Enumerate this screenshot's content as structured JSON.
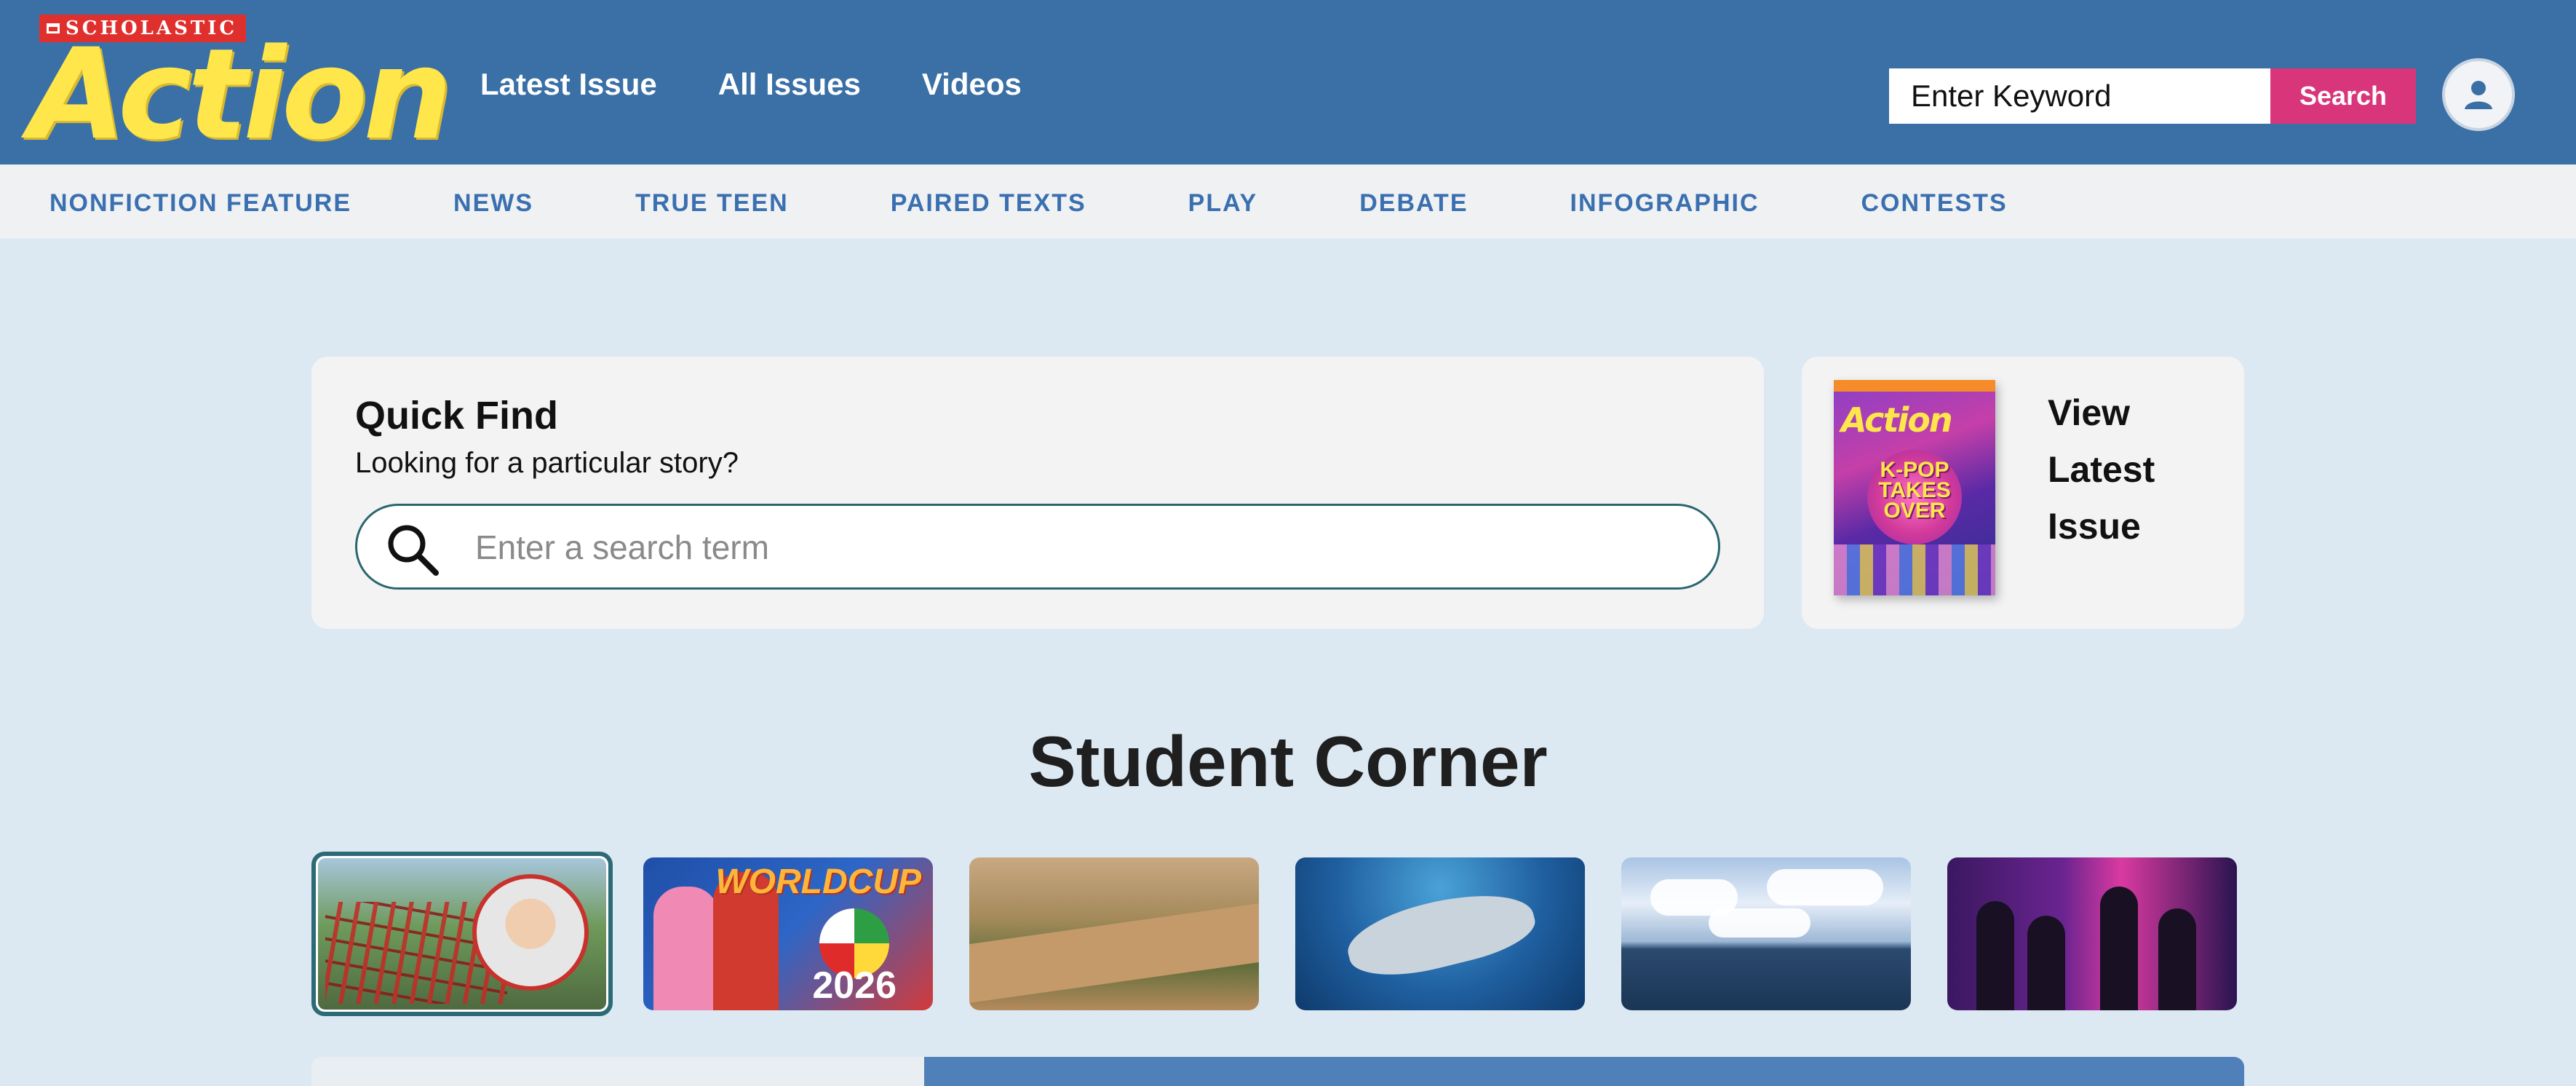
{
  "header": {
    "logo_badge": "SCHOLASTIC",
    "logo_word": "Action",
    "nav": [
      "Latest Issue",
      "All Issues",
      "Videos"
    ],
    "search": {
      "placeholder": "Enter Keyword",
      "button_label": "Search"
    },
    "account_icon": "user-icon"
  },
  "sub_nav": {
    "items": [
      "NONFICTION FEATURE",
      "NEWS",
      "TRUE TEEN",
      "PAIRED TEXTS",
      "PLAY",
      "DEBATE",
      "INFOGRAPHIC",
      "CONTESTS"
    ]
  },
  "quick_find": {
    "title": "Quick Find",
    "subtitle": "Looking for a particular story?",
    "placeholder": "Enter a search term",
    "icon": "search-icon"
  },
  "latest_issue": {
    "cover_logo": "Action",
    "cover_headline": [
      "K-POP",
      "TAKES",
      "OVER"
    ],
    "label_lines": [
      "View",
      "Latest",
      "Issue"
    ]
  },
  "student_corner": {
    "title": "Student Corner",
    "thumbnails": [
      {
        "name": "roller-coaster",
        "selected": true
      },
      {
        "name": "world-cup",
        "title": "WORLDCUP",
        "year": "2026",
        "selected": false
      },
      {
        "name": "river",
        "selected": false
      },
      {
        "name": "shark",
        "selected": false
      },
      {
        "name": "lake-sky",
        "selected": false
      },
      {
        "name": "kpop-performers",
        "selected": false
      }
    ]
  },
  "colors": {
    "header_bg": "#3a70a6",
    "logo_yellow": "#ffe64b",
    "search_button": "#d9357a",
    "sub_nav_text": "#3a6fb0",
    "page_bg": "#dce9f2"
  }
}
